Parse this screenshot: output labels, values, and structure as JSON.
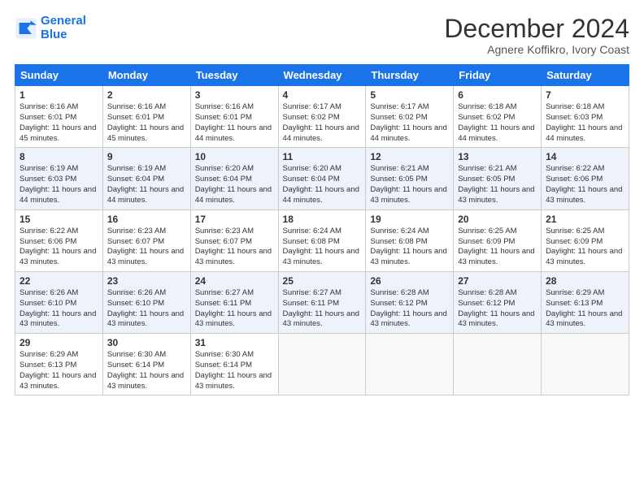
{
  "header": {
    "logo_line1": "General",
    "logo_line2": "Blue",
    "month_title": "December 2024",
    "location": "Agnere Koffikro, Ivory Coast"
  },
  "days_of_week": [
    "Sunday",
    "Monday",
    "Tuesday",
    "Wednesday",
    "Thursday",
    "Friday",
    "Saturday"
  ],
  "weeks": [
    [
      {
        "day": "1",
        "text": "Sunrise: 6:16 AM\nSunset: 6:01 PM\nDaylight: 11 hours and 45 minutes."
      },
      {
        "day": "2",
        "text": "Sunrise: 6:16 AM\nSunset: 6:01 PM\nDaylight: 11 hours and 45 minutes."
      },
      {
        "day": "3",
        "text": "Sunrise: 6:16 AM\nSunset: 6:01 PM\nDaylight: 11 hours and 44 minutes."
      },
      {
        "day": "4",
        "text": "Sunrise: 6:17 AM\nSunset: 6:02 PM\nDaylight: 11 hours and 44 minutes."
      },
      {
        "day": "5",
        "text": "Sunrise: 6:17 AM\nSunset: 6:02 PM\nDaylight: 11 hours and 44 minutes."
      },
      {
        "day": "6",
        "text": "Sunrise: 6:18 AM\nSunset: 6:02 PM\nDaylight: 11 hours and 44 minutes."
      },
      {
        "day": "7",
        "text": "Sunrise: 6:18 AM\nSunset: 6:03 PM\nDaylight: 11 hours and 44 minutes."
      }
    ],
    [
      {
        "day": "8",
        "text": "Sunrise: 6:19 AM\nSunset: 6:03 PM\nDaylight: 11 hours and 44 minutes."
      },
      {
        "day": "9",
        "text": "Sunrise: 6:19 AM\nSunset: 6:04 PM\nDaylight: 11 hours and 44 minutes."
      },
      {
        "day": "10",
        "text": "Sunrise: 6:20 AM\nSunset: 6:04 PM\nDaylight: 11 hours and 44 minutes."
      },
      {
        "day": "11",
        "text": "Sunrise: 6:20 AM\nSunset: 6:04 PM\nDaylight: 11 hours and 44 minutes."
      },
      {
        "day": "12",
        "text": "Sunrise: 6:21 AM\nSunset: 6:05 PM\nDaylight: 11 hours and 43 minutes."
      },
      {
        "day": "13",
        "text": "Sunrise: 6:21 AM\nSunset: 6:05 PM\nDaylight: 11 hours and 43 minutes."
      },
      {
        "day": "14",
        "text": "Sunrise: 6:22 AM\nSunset: 6:06 PM\nDaylight: 11 hours and 43 minutes."
      }
    ],
    [
      {
        "day": "15",
        "text": "Sunrise: 6:22 AM\nSunset: 6:06 PM\nDaylight: 11 hours and 43 minutes."
      },
      {
        "day": "16",
        "text": "Sunrise: 6:23 AM\nSunset: 6:07 PM\nDaylight: 11 hours and 43 minutes."
      },
      {
        "day": "17",
        "text": "Sunrise: 6:23 AM\nSunset: 6:07 PM\nDaylight: 11 hours and 43 minutes."
      },
      {
        "day": "18",
        "text": "Sunrise: 6:24 AM\nSunset: 6:08 PM\nDaylight: 11 hours and 43 minutes."
      },
      {
        "day": "19",
        "text": "Sunrise: 6:24 AM\nSunset: 6:08 PM\nDaylight: 11 hours and 43 minutes."
      },
      {
        "day": "20",
        "text": "Sunrise: 6:25 AM\nSunset: 6:09 PM\nDaylight: 11 hours and 43 minutes."
      },
      {
        "day": "21",
        "text": "Sunrise: 6:25 AM\nSunset: 6:09 PM\nDaylight: 11 hours and 43 minutes."
      }
    ],
    [
      {
        "day": "22",
        "text": "Sunrise: 6:26 AM\nSunset: 6:10 PM\nDaylight: 11 hours and 43 minutes."
      },
      {
        "day": "23",
        "text": "Sunrise: 6:26 AM\nSunset: 6:10 PM\nDaylight: 11 hours and 43 minutes."
      },
      {
        "day": "24",
        "text": "Sunrise: 6:27 AM\nSunset: 6:11 PM\nDaylight: 11 hours and 43 minutes."
      },
      {
        "day": "25",
        "text": "Sunrise: 6:27 AM\nSunset: 6:11 PM\nDaylight: 11 hours and 43 minutes."
      },
      {
        "day": "26",
        "text": "Sunrise: 6:28 AM\nSunset: 6:12 PM\nDaylight: 11 hours and 43 minutes."
      },
      {
        "day": "27",
        "text": "Sunrise: 6:28 AM\nSunset: 6:12 PM\nDaylight: 11 hours and 43 minutes."
      },
      {
        "day": "28",
        "text": "Sunrise: 6:29 AM\nSunset: 6:13 PM\nDaylight: 11 hours and 43 minutes."
      }
    ],
    [
      {
        "day": "29",
        "text": "Sunrise: 6:29 AM\nSunset: 6:13 PM\nDaylight: 11 hours and 43 minutes."
      },
      {
        "day": "30",
        "text": "Sunrise: 6:30 AM\nSunset: 6:14 PM\nDaylight: 11 hours and 43 minutes."
      },
      {
        "day": "31",
        "text": "Sunrise: 6:30 AM\nSunset: 6:14 PM\nDaylight: 11 hours and 43 minutes."
      },
      {
        "day": "",
        "text": ""
      },
      {
        "day": "",
        "text": ""
      },
      {
        "day": "",
        "text": ""
      },
      {
        "day": "",
        "text": ""
      }
    ]
  ]
}
